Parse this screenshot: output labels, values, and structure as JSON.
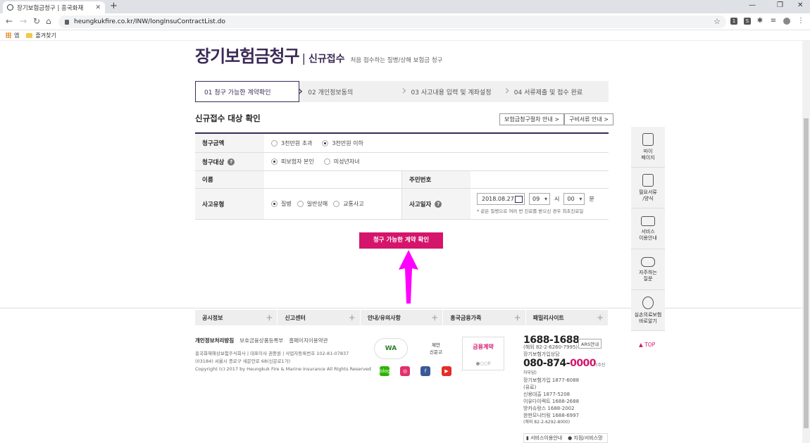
{
  "browser": {
    "tab_title": "장기보험금청구 | 흥국화재",
    "url": "heungkukfire.co.kr/INW/longInsuContractList.do",
    "bookmarks": [
      "앱",
      "즐겨찾기"
    ]
  },
  "header": {
    "title": "장기보험금청구",
    "separator": "|",
    "subtitle": "신규접수",
    "description": "처음 접수하는 질병/상해 보험금 청구"
  },
  "steps": [
    {
      "label": "01 청구 가능한 계약확인"
    },
    {
      "label": "02 개인정보동의"
    },
    {
      "label": "03 사고내용 입력 및 계좌설정"
    },
    {
      "label": "04 서류제출 및 접수 완료"
    }
  ],
  "section": {
    "title": "신규접수 대상 확인",
    "guide_btn1": "보험금청구절차 안내 >",
    "guide_btn2": "구비서류 안내 >"
  },
  "form": {
    "amount_label": "청구금액",
    "amount_options": [
      "3천만원 초과",
      "3천만원 이하"
    ],
    "target_label": "청구대상",
    "target_options": [
      "피보험자 본인",
      "미성년자녀"
    ],
    "name_label": "이름",
    "rrn_label": "주민번호",
    "type_label": "사고유형",
    "type_options": [
      "질병",
      "일반상해",
      "교통사고"
    ],
    "date_label": "사고일자",
    "date_value": "2018.08.27",
    "hour_value": "09",
    "hour_unit": "시",
    "min_value": "00",
    "min_unit": "분",
    "date_note": "* 같은 질병으로 여러 번 진료를 받으신 경우 최초진료일",
    "help_glyph": "?"
  },
  "cta_label": "청구 가능한 계약 확인",
  "footer_menu": [
    "공시정보",
    "신고센터",
    "안내/유의사항",
    "흥국금융가족",
    "패밀리사이트"
  ],
  "footer_links": {
    "privacy": "개인정보처리방침",
    "link2": "보호금융상품등록부",
    "link3": "홈페이지이용약관"
  },
  "footer_info": {
    "line1": "흥국화재해상보험주식회사 | 대표이사 권중원 | 사업자등록번호 102-81-07837",
    "line2": "(03184) 서울시 종로구 새문안로 68(신문로1가)",
    "copyright": "Copyright (c) 2017 by Heungkuk Fire & Marine Insurance All Rights Reserved"
  },
  "badges": {
    "wa": "WA",
    "reporter_line1": "제안",
    "reporter_line2": "신문고",
    "campaign": "금융계약",
    "dots": "●○○ll"
  },
  "sns": [
    {
      "name": "blog",
      "label": "blog",
      "color": "#2db400"
    },
    {
      "name": "instagram",
      "label": "◎",
      "color": "#e1306c"
    },
    {
      "name": "facebook",
      "label": "f",
      "color": "#3b5998"
    },
    {
      "name": "youtube",
      "label": "▶",
      "color": "#e52d27"
    }
  ],
  "contact": {
    "main_phone": "1688-1688",
    "ars": "ARS안내",
    "overseas1": "(해외 82-2-6260-7995)",
    "subscribe_label": "장기보험가입상담",
    "phone2_a": "080-874-",
    "phone2_b": "0000",
    "phone2_note": "(수신자부담)",
    "line_a": "장기보험가입 1877-6088",
    "line_b": "(유료)",
    "line_c": "신용대출      1877-5208",
    "line_d": "이유다이렉트  1688-2688",
    "line_e": "방카슈랑스    1688-2002",
    "line_f": "완판모니터링 1688-6997",
    "line_g": "(해외 82-2-6292-8000)",
    "bottom1": "서비스이용안내",
    "bottom2": "지점/서비스망"
  },
  "quick_menu": [
    {
      "label": "마이\n페이지"
    },
    {
      "label": "필요서류\n/양식"
    },
    {
      "label": "서비스\n이용안내"
    },
    {
      "label": "자주하는\n질문"
    },
    {
      "label": "실손의료보험\n바로알기"
    }
  ],
  "top_label": "▲ TOP",
  "colors": {
    "accent": "#3a2a55",
    "cta": "#d5156b",
    "annotation": "#ff00ff"
  }
}
